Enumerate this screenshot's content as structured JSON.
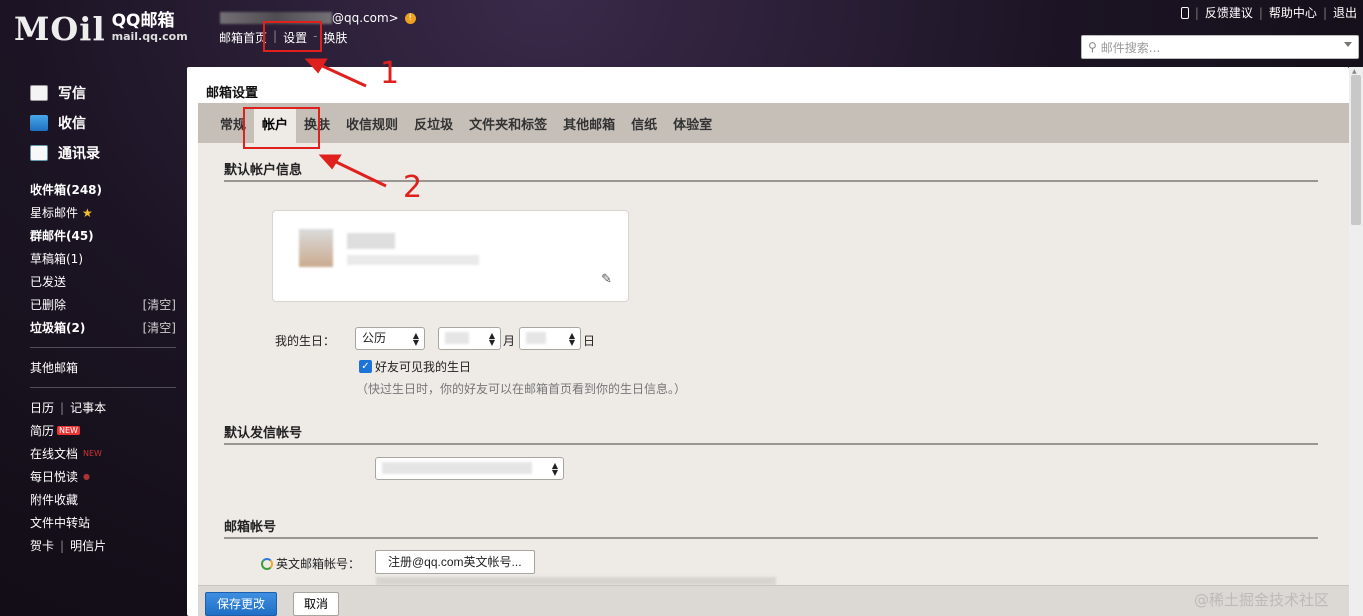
{
  "header": {
    "logo_mark": "MOil",
    "logo_title": "QQ邮箱",
    "logo_domain": "mail.qq.com",
    "account_suffix": "@qq.com>",
    "nav": [
      "邮箱首页",
      "设置",
      "换肤"
    ],
    "links": [
      "反馈建议",
      "帮助中心",
      "退出"
    ],
    "search_placeholder": "邮件搜索..."
  },
  "annotations": [
    "1",
    "2"
  ],
  "sidebar": {
    "main": [
      "写信",
      "收信",
      "通讯录"
    ],
    "folders": [
      {
        "label": "收件箱(248)",
        "bold": true
      },
      {
        "label": "星标邮件",
        "star": true
      },
      {
        "label": "群邮件(45)",
        "bold": true
      },
      {
        "label": "草稿箱(1)"
      },
      {
        "label": "已发送"
      },
      {
        "label": "已删除",
        "action": "[清空]"
      },
      {
        "label": "垃圾箱(2)",
        "bold": true,
        "action": "[清空]"
      }
    ],
    "other": "其他邮箱",
    "apps": {
      "calendar": "日历",
      "notes": "记事本",
      "resume": "简历",
      "docs": "在线文档",
      "daily": "每日悦读",
      "attachments": "附件收藏",
      "transfer": "文件中转站",
      "card": "贺卡",
      "postcard": "明信片",
      "new_badge": "NEW"
    }
  },
  "panel": {
    "title": "邮箱设置",
    "tabs": [
      "常规",
      "帐户",
      "换肤",
      "收信规则",
      "反垃圾",
      "文件夹和标签",
      "其他邮箱",
      "信纸",
      "体验室"
    ],
    "active_tab": "帐户",
    "section_account": "默认帐户信息",
    "birthday_label": "我的生日：",
    "calendar_select": "公历",
    "month_unit": "月",
    "day_unit": "日",
    "birthday_visible": "好友可见我的生日",
    "birthday_hint": "（快过生日时，你的好友可以在邮箱首页看到你的生日信息。）",
    "section_sender": "默认发信帐号",
    "section_mailbox": "邮箱帐号",
    "english_label": "英文邮箱帐号：",
    "register_button": "注册@qq.com英文帐号...",
    "save_button": "保存更改",
    "cancel_button": "取消",
    "watermark": "@稀土掘金技术社区"
  },
  "colors": {
    "annotation": "#e0201c",
    "primary_button": "#1f6fc6",
    "tab_bar": "#c5bfb8",
    "content_bg": "#eeebe7"
  }
}
